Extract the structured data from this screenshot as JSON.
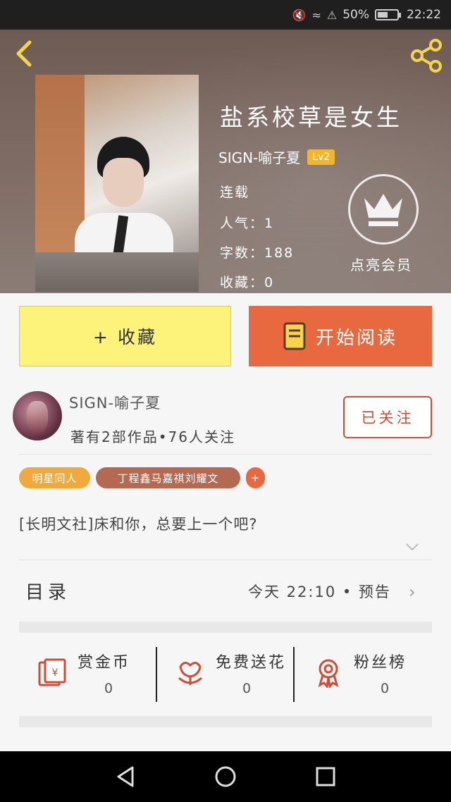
{
  "status_bar": {
    "battery_percent": "50%",
    "time": "22:22"
  },
  "book": {
    "title": "盐系校草是女生",
    "author": "SIGN-喻子夏",
    "level": "Lv2",
    "status": "连载",
    "popularity_label": "人气：1",
    "word_count_label": "字数：188",
    "collect_count_label": "收藏：0"
  },
  "vip": {
    "label": "点亮会员"
  },
  "actions": {
    "collect_label": "+ 收藏",
    "read_label": "开始阅读"
  },
  "author_card": {
    "name": "SIGN-喻子夏",
    "stats": "著有2部作品•76人关注",
    "follow_label": "已关注"
  },
  "tags": {
    "star": "明星同人",
    "ship": "丁程鑫马嘉祺刘耀文",
    "add": "+"
  },
  "synopsis": "[长明文社]床和你，总要上一个吧?",
  "toc": {
    "label": "目录",
    "info": "今天 22:10 • 预告"
  },
  "stats": [
    {
      "label": "赏金币",
      "value": "0",
      "icon": "red-envelope-icon"
    },
    {
      "label": "免费送花",
      "value": "0",
      "icon": "flower-icon"
    },
    {
      "label": "粉丝榜",
      "value": "0",
      "icon": "medal-icon"
    }
  ],
  "colors": {
    "accent_orange": "#e8683f",
    "collect_yellow": "#fdf27a",
    "follow_red": "#d14b35",
    "level_gold": "#f0b72d",
    "back_yellow": "#f2d54a"
  },
  "nav": {
    "back_icon": "triangle-back-icon",
    "home_icon": "circle-home-icon",
    "recents_icon": "square-recents-icon"
  }
}
